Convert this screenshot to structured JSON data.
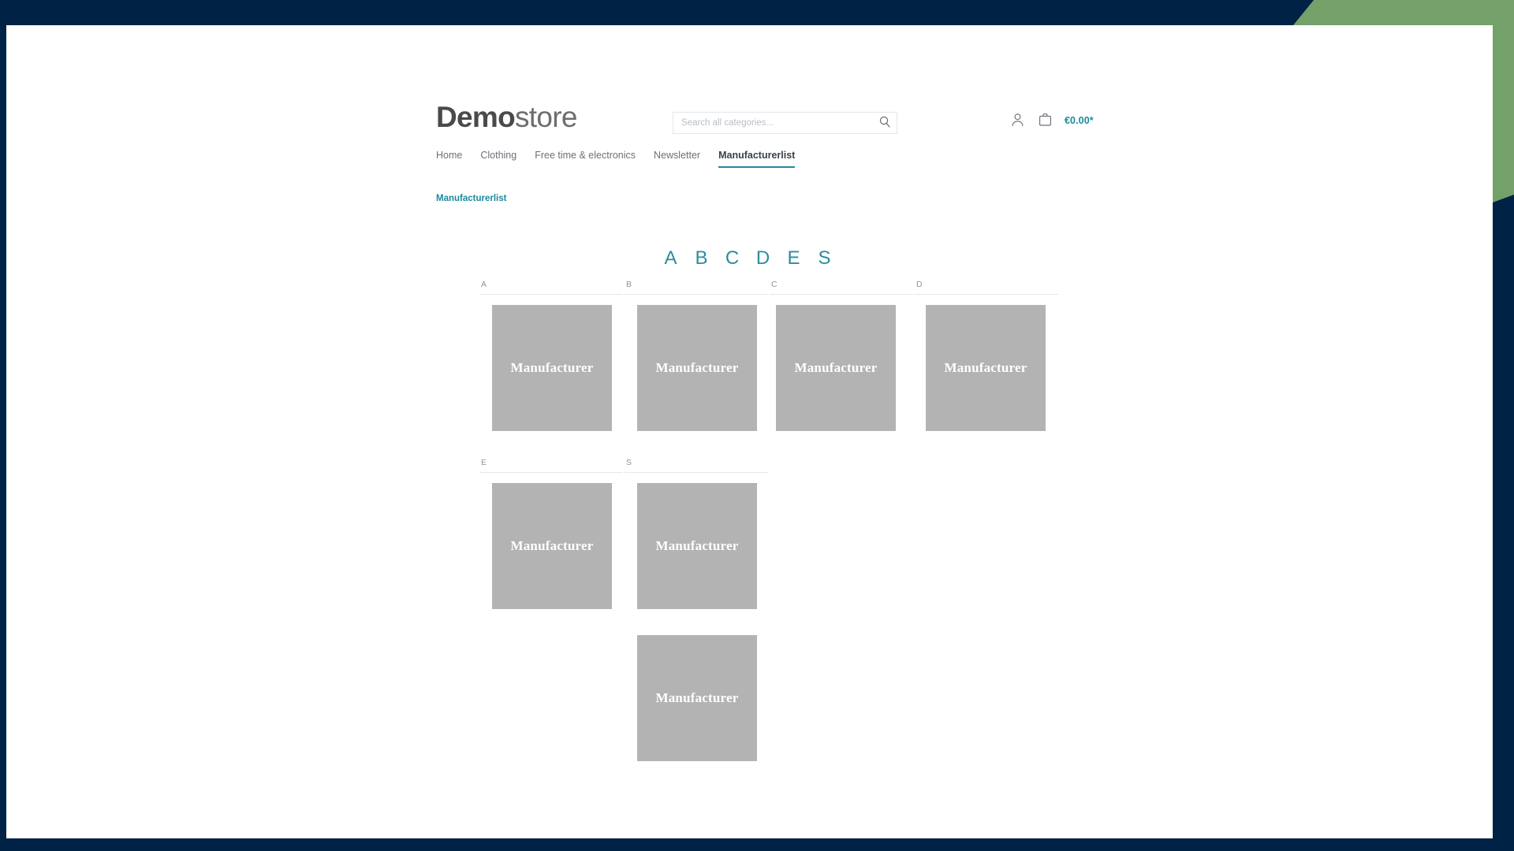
{
  "frame": {
    "navy": "#002244",
    "green": "#74a06a"
  },
  "header": {
    "logo_bold": "Demo",
    "logo_light": "store",
    "search": {
      "placeholder": "Search all categories...",
      "value": "",
      "icon": "search-icon"
    },
    "account_icon": "person-icon",
    "cart_icon": "shopping-bag-icon",
    "cart_total": "€0.00*",
    "accent_color": "#1b8a9c"
  },
  "nav": {
    "items": [
      {
        "label": "Home",
        "active": false
      },
      {
        "label": "Clothing",
        "active": false
      },
      {
        "label": "Free time & electronics",
        "active": false
      },
      {
        "label": "Newsletter",
        "active": false
      },
      {
        "label": "Manufacturerlist",
        "active": true
      }
    ]
  },
  "breadcrumb": {
    "label": "Manufacturerlist"
  },
  "alphabet_filter": {
    "letters": [
      "A",
      "B",
      "C",
      "D",
      "E",
      "S"
    ],
    "color": "#2b8c9e"
  },
  "manufacturer_groups": [
    {
      "letter": "A",
      "tiles": [
        {
          "label": "Manufacturer"
        }
      ]
    },
    {
      "letter": "B",
      "tiles": [
        {
          "label": "Manufacturer"
        }
      ]
    },
    {
      "letter": "C",
      "tiles": [
        {
          "label": "Manufacturer"
        }
      ]
    },
    {
      "letter": "D",
      "tiles": [
        {
          "label": "Manufacturer"
        }
      ]
    },
    {
      "letter": "E",
      "tiles": [
        {
          "label": "Manufacturer"
        }
      ]
    },
    {
      "letter": "S",
      "tiles": [
        {
          "label": "Manufacturer"
        },
        {
          "label": "Manufacturer"
        }
      ]
    }
  ],
  "tile_style": {
    "placeholder_color": "#b3b3b3",
    "label_color": "#ffffff"
  }
}
